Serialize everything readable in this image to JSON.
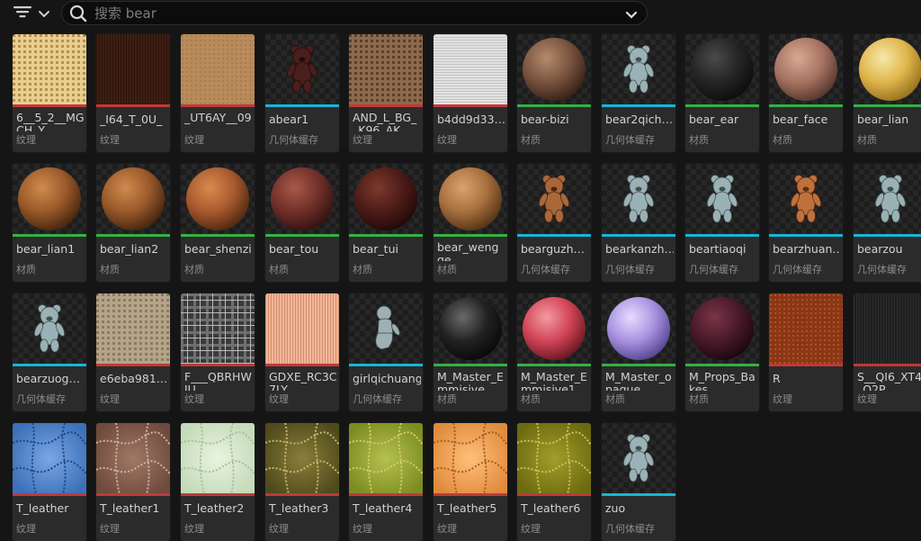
{
  "toolbar": {
    "search_placeholder": "搜索 bear"
  },
  "colors": {
    "texture": "#c0393a",
    "geometry_cache": "#17b6d4",
    "material": "#33b243"
  },
  "items": [
    {
      "name": "6__5_2__MGCH_Y",
      "type": "纹理",
      "category": "texture",
      "thumb": "tex-burlap",
      "wrap": true
    },
    {
      "name": "_I64_T_0U_",
      "type": "纹理",
      "category": "texture",
      "thumb": "tex-darkbrown",
      "wrap": false
    },
    {
      "name": "_UT6AY__09",
      "type": "纹理",
      "category": "texture",
      "thumb": "tex-tan",
      "wrap": true
    },
    {
      "name": "abear1",
      "type": "几何体缓存",
      "category": "geometry_cache",
      "thumb": "bear-dark",
      "wrap": false
    },
    {
      "name": "AND_L_BG__K96_AK",
      "type": "纹理",
      "category": "texture",
      "thumb": "tex-tweed",
      "wrap": true
    },
    {
      "name": "b4dd9d33…",
      "type": "纹理",
      "category": "texture",
      "thumb": "tex-white",
      "wrap": false
    },
    {
      "name": "bear-bizi",
      "type": "材质",
      "category": "material",
      "thumb": "sphere-brownfur",
      "wrap": false
    },
    {
      "name": "bear2qich…",
      "type": "几何体缓存",
      "category": "geometry_cache",
      "thumb": "bear-grey",
      "wrap": false
    },
    {
      "name": "bear_ear",
      "type": "材质",
      "category": "material",
      "thumb": "sphere-black",
      "wrap": false
    },
    {
      "name": "bear_face",
      "type": "材质",
      "category": "material",
      "thumb": "sphere-skin",
      "wrap": false
    },
    {
      "name": "bear_lian",
      "type": "材质",
      "category": "material",
      "thumb": "sphere-yellowcheck",
      "wrap": false
    },
    {
      "name": "bear_lian1",
      "type": "材质",
      "category": "material",
      "thumb": "sphere-orangefur",
      "wrap": false
    },
    {
      "name": "bear_lian2",
      "type": "材质",
      "category": "material",
      "thumb": "sphere-orangefur",
      "wrap": false
    },
    {
      "name": "bear_shenzi",
      "type": "材质",
      "category": "material",
      "thumb": "sphere-copper",
      "wrap": false
    },
    {
      "name": "bear_tou",
      "type": "材质",
      "category": "material",
      "thumb": "sphere-redbrown",
      "wrap": false
    },
    {
      "name": "bear_tui",
      "type": "材质",
      "category": "material",
      "thumb": "sphere-darkred",
      "wrap": false
    },
    {
      "name": "bear_wengge",
      "type": "材质",
      "category": "material",
      "thumb": "sphere-lightfur",
      "wrap": true
    },
    {
      "name": "bearguzh…",
      "type": "几何体缓存",
      "category": "geometry_cache",
      "thumb": "bear-brown",
      "wrap": false
    },
    {
      "name": "bearkanzh…",
      "type": "几何体缓存",
      "category": "geometry_cache",
      "thumb": "bear-grey",
      "wrap": false
    },
    {
      "name": "beartiaoqi",
      "type": "几何体缓存",
      "category": "geometry_cache",
      "thumb": "bear-grey",
      "wrap": false
    },
    {
      "name": "bearzhuan…",
      "type": "几何体缓存",
      "category": "geometry_cache",
      "thumb": "bear-orange",
      "wrap": false
    },
    {
      "name": "bearzou",
      "type": "几何体缓存",
      "category": "geometry_cache",
      "thumb": "bear-grey",
      "wrap": false
    },
    {
      "name": "bearzuog…",
      "type": "几何体缓存",
      "category": "geometry_cache",
      "thumb": "bear-grey",
      "wrap": false
    },
    {
      "name": "e6eba981…",
      "type": "纹理",
      "category": "texture",
      "thumb": "tex-linen",
      "wrap": false
    },
    {
      "name": "F___QBRHWIU",
      "type": "纹理",
      "category": "texture",
      "thumb": "tex-plaid",
      "wrap": true
    },
    {
      "name": "GDXE_RC3C7LY",
      "type": "纹理",
      "category": "texture",
      "thumb": "tex-peach",
      "wrap": true
    },
    {
      "name": "girlqichuang",
      "type": "几何体缓存",
      "category": "geometry_cache",
      "thumb": "figure-grey",
      "wrap": false
    },
    {
      "name": "M_Master_Emmisive",
      "type": "材质",
      "category": "material",
      "thumb": "sphere-glossblack",
      "wrap": true
    },
    {
      "name": "M_Master_Emmisive1",
      "type": "材质",
      "category": "material",
      "thumb": "sphere-red",
      "wrap": true
    },
    {
      "name": "M_Master_opaque",
      "type": "材质",
      "category": "material",
      "thumb": "sphere-lavender",
      "wrap": true
    },
    {
      "name": "M_Props_Bakes",
      "type": "材质",
      "category": "material",
      "thumb": "sphere-wine",
      "wrap": true
    },
    {
      "name": "R",
      "type": "纹理",
      "category": "texture",
      "thumb": "tex-rust",
      "wrap": false
    },
    {
      "name": "S__QI6_XT4_Q2P",
      "type": "纹理",
      "category": "texture",
      "thumb": "tex-charcoal",
      "wrap": true
    },
    {
      "name": "T_leather",
      "type": "纹理",
      "category": "texture",
      "thumb": "leather-blue",
      "wrap": false
    },
    {
      "name": "T_leather1",
      "type": "纹理",
      "category": "texture",
      "thumb": "leather-brown",
      "wrap": false
    },
    {
      "name": "T_leather2",
      "type": "纹理",
      "category": "texture",
      "thumb": "leather-mint",
      "wrap": false
    },
    {
      "name": "T_leather3",
      "type": "纹理",
      "category": "texture",
      "thumb": "leather-olive",
      "wrap": false
    },
    {
      "name": "T_leather4",
      "type": "纹理",
      "category": "texture",
      "thumb": "leather-lime",
      "wrap": false
    },
    {
      "name": "T_leather5",
      "type": "纹理",
      "category": "texture",
      "thumb": "leather-orange",
      "wrap": false
    },
    {
      "name": "T_leather6",
      "type": "纹理",
      "category": "texture",
      "thumb": "leather-mustard",
      "wrap": false
    },
    {
      "name": "zuo",
      "type": "几何体缓存",
      "category": "geometry_cache",
      "thumb": "bear-grey",
      "wrap": false
    }
  ]
}
